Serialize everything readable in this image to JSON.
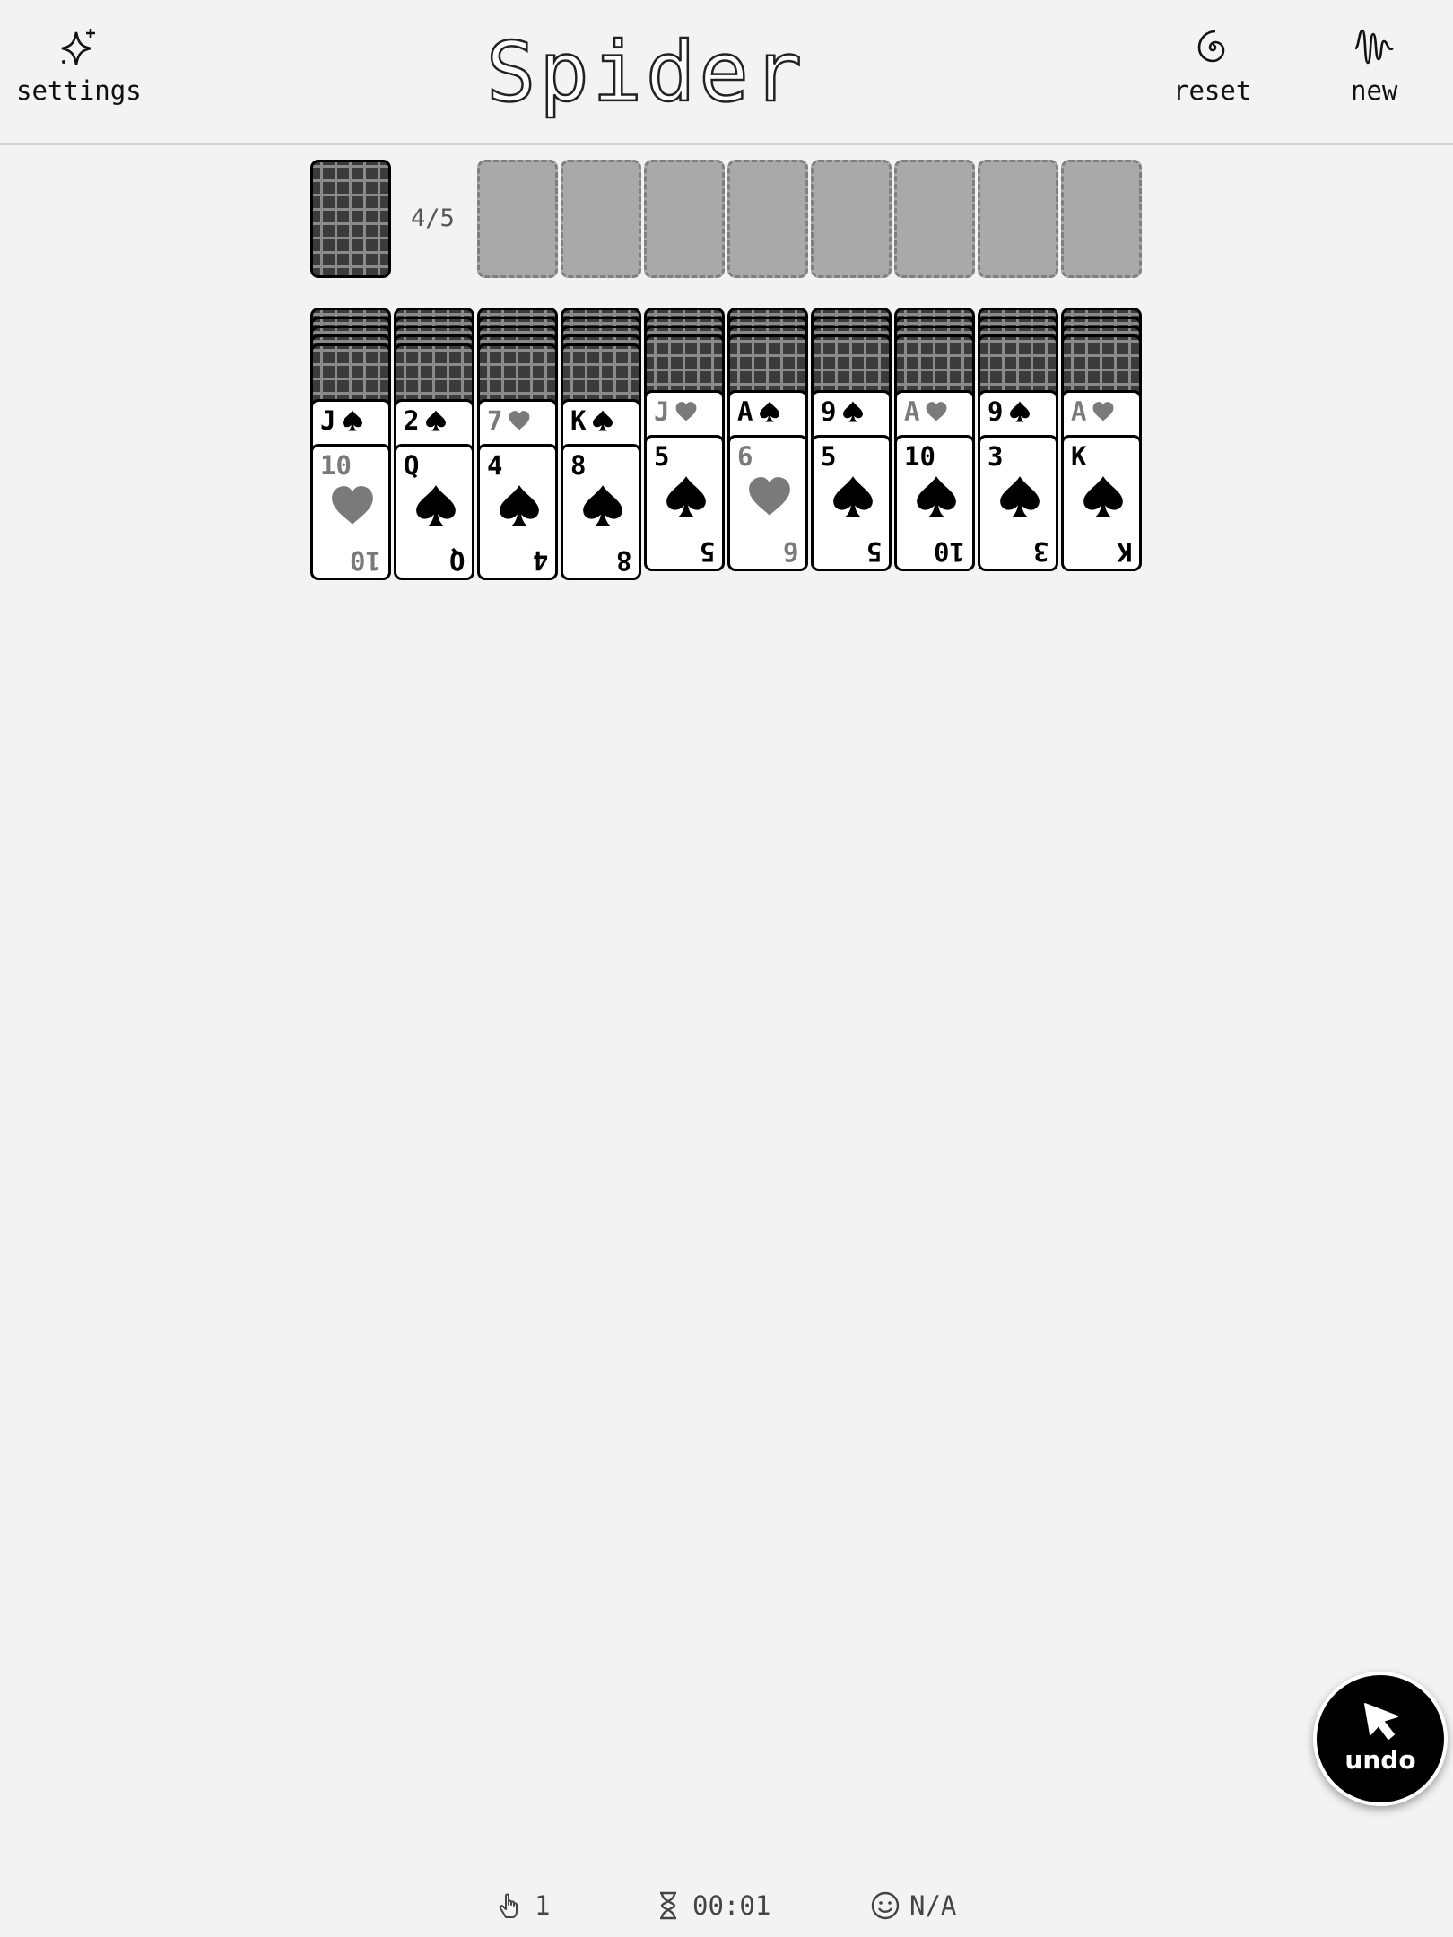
{
  "header": {
    "title": "Spider",
    "settings_label": "settings",
    "reset_label": "reset",
    "new_label": "new"
  },
  "stock": {
    "count_text": "4/5"
  },
  "foundations": {
    "empty_slots": 8
  },
  "tableau": [
    {
      "face_down": 5,
      "face_up": [
        {
          "rank": "J",
          "suit": "spade"
        },
        {
          "rank": "10",
          "suit": "heart"
        }
      ]
    },
    {
      "face_down": 5,
      "face_up": [
        {
          "rank": "2",
          "suit": "spade"
        },
        {
          "rank": "Q",
          "suit": "spade"
        }
      ]
    },
    {
      "face_down": 5,
      "face_up": [
        {
          "rank": "7",
          "suit": "heart"
        },
        {
          "rank": "4",
          "suit": "spade"
        }
      ]
    },
    {
      "face_down": 5,
      "face_up": [
        {
          "rank": "K",
          "suit": "spade"
        },
        {
          "rank": "8",
          "suit": "spade"
        }
      ]
    },
    {
      "face_down": 4,
      "face_up": [
        {
          "rank": "J",
          "suit": "heart"
        },
        {
          "rank": "5",
          "suit": "spade"
        }
      ]
    },
    {
      "face_down": 4,
      "face_up": [
        {
          "rank": "A",
          "suit": "spade"
        },
        {
          "rank": "6",
          "suit": "heart"
        }
      ]
    },
    {
      "face_down": 4,
      "face_up": [
        {
          "rank": "9",
          "suit": "spade"
        },
        {
          "rank": "5",
          "suit": "spade"
        }
      ]
    },
    {
      "face_down": 4,
      "face_up": [
        {
          "rank": "A",
          "suit": "heart"
        },
        {
          "rank": "10",
          "suit": "spade"
        }
      ]
    },
    {
      "face_down": 4,
      "face_up": [
        {
          "rank": "9",
          "suit": "spade"
        },
        {
          "rank": "3",
          "suit": "spade"
        }
      ]
    },
    {
      "face_down": 4,
      "face_up": [
        {
          "rank": "A",
          "suit": "heart"
        },
        {
          "rank": "K",
          "suit": "spade"
        }
      ]
    }
  ],
  "undo_label": "undo",
  "status": {
    "moves": "1",
    "time": "00:01",
    "score": "N/A"
  },
  "colors": {
    "background": "#f3f3f3",
    "black_suit": "#000000",
    "red_suit": "#7a7a7a",
    "slot": "#a9a9a9"
  },
  "icons": {
    "settings": "sparkle-icon",
    "reset": "spiral-icon",
    "new": "wave-icon",
    "undo": "cursor-arrow-icon",
    "moves": "hand-pointer-icon",
    "time": "hourglass-icon",
    "score": "smiley-icon"
  }
}
